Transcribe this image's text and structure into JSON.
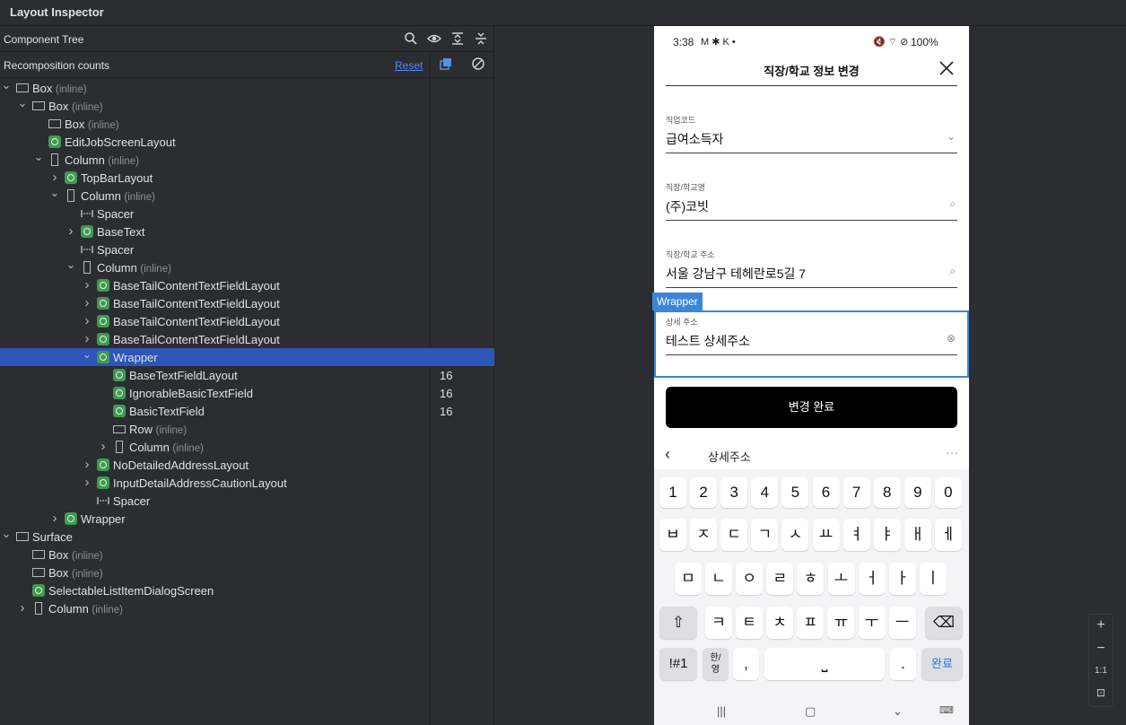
{
  "app": {
    "title": "Layout Inspector"
  },
  "component_tree": {
    "label": "Component Tree",
    "icons": [
      "search-icon",
      "eye-icon",
      "expand-all-icon",
      "collapse-all-icon"
    ]
  },
  "recomposition": {
    "label": "Recomposition counts",
    "reset_label": "Reset"
  },
  "tree_rows": [
    {
      "name": "Box",
      "inline": "(inline)",
      "type": "box",
      "depth": 0,
      "arrow": "v"
    },
    {
      "name": "Box",
      "inline": "(inline)",
      "type": "box",
      "depth": 1,
      "arrow": "v"
    },
    {
      "name": "Box",
      "inline": "(inline)",
      "type": "box",
      "depth": 2,
      "arrow": ""
    },
    {
      "name": "EditJobScreenLayout",
      "inline": "",
      "type": "compose",
      "depth": 2,
      "arrow": ""
    },
    {
      "name": "Column",
      "inline": "(inline)",
      "type": "col",
      "depth": 2,
      "arrow": "v"
    },
    {
      "name": "TopBarLayout",
      "inline": "",
      "type": "compose",
      "depth": 3,
      "arrow": ">"
    },
    {
      "name": "Column",
      "inline": "(inline)",
      "type": "col",
      "depth": 3,
      "arrow": "v"
    },
    {
      "name": "Spacer",
      "inline": "",
      "type": "spacer",
      "depth": 4,
      "arrow": ""
    },
    {
      "name": "BaseText",
      "inline": "",
      "type": "compose",
      "depth": 4,
      "arrow": ">"
    },
    {
      "name": "Spacer",
      "inline": "",
      "type": "spacer",
      "depth": 4,
      "arrow": ""
    },
    {
      "name": "Column",
      "inline": "(inline)",
      "type": "col",
      "depth": 4,
      "arrow": "v"
    },
    {
      "name": "BaseTailContentTextFieldLayout",
      "inline": "",
      "type": "compose",
      "depth": 5,
      "arrow": ">"
    },
    {
      "name": "BaseTailContentTextFieldLayout",
      "inline": "",
      "type": "compose",
      "depth": 5,
      "arrow": ">"
    },
    {
      "name": "BaseTailContentTextFieldLayout",
      "inline": "",
      "type": "compose",
      "depth": 5,
      "arrow": ">"
    },
    {
      "name": "BaseTailContentTextFieldLayout",
      "inline": "",
      "type": "compose",
      "depth": 5,
      "arrow": ">"
    },
    {
      "name": "Wrapper",
      "inline": "",
      "type": "compose",
      "depth": 5,
      "arrow": "v",
      "selected": true
    },
    {
      "name": "BaseTextFieldLayout",
      "inline": "",
      "type": "compose",
      "depth": 6,
      "arrow": "",
      "count": "16"
    },
    {
      "name": "IgnorableBasicTextField",
      "inline": "",
      "type": "compose",
      "depth": 6,
      "arrow": "",
      "count": "16"
    },
    {
      "name": "BasicTextField",
      "inline": "",
      "type": "compose",
      "depth": 6,
      "arrow": "",
      "count": "16"
    },
    {
      "name": "Row",
      "inline": "(inline)",
      "type": "row",
      "depth": 6,
      "arrow": ""
    },
    {
      "name": "Column",
      "inline": "(inline)",
      "type": "col",
      "depth": 6,
      "arrow": ">"
    },
    {
      "name": "NoDetailedAddressLayout",
      "inline": "",
      "type": "compose",
      "depth": 5,
      "arrow": ">"
    },
    {
      "name": "InputDetailAddressCautionLayout",
      "inline": "",
      "type": "compose",
      "depth": 5,
      "arrow": ">"
    },
    {
      "name": "Spacer",
      "inline": "",
      "type": "spacer",
      "depth": 5,
      "arrow": ""
    },
    {
      "name": "Wrapper",
      "inline": "",
      "type": "compose",
      "depth": 3,
      "arrow": ">"
    },
    {
      "name": "Surface",
      "inline": "",
      "type": "box",
      "depth": 0,
      "arrow": "v"
    },
    {
      "name": "Box",
      "inline": "(inline)",
      "type": "box",
      "depth": 1,
      "arrow": ""
    },
    {
      "name": "Box",
      "inline": "(inline)",
      "type": "box",
      "depth": 1,
      "arrow": ""
    },
    {
      "name": "SelectableListItemDialogScreen",
      "inline": "",
      "type": "compose",
      "depth": 1,
      "arrow": ""
    },
    {
      "name": "Column",
      "inline": "(inline)",
      "type": "col",
      "depth": 1,
      "arrow": ">"
    }
  ],
  "phone": {
    "status": {
      "time": "3:38",
      "left_icons": "M ✱ K •",
      "right_icons": "🔇 ⌔ ⊘",
      "battery": "100%"
    },
    "topbar_title": "직장/학교 정보 변경",
    "fields": [
      {
        "label": "직업코드",
        "value": "급여소득자",
        "icon": "chevron-down-icon",
        "glyph": "⌄"
      },
      {
        "label": "직장/학교명",
        "value": "(주)코빗",
        "icon": "search-icon",
        "glyph": "⌕"
      },
      {
        "label": "직장/학교 주소",
        "value": "서울 강남구 테헤란로5길 7",
        "icon": "search-icon",
        "glyph": "⌕"
      },
      {
        "label": "상세 주소",
        "value": "테스트 상세주소",
        "icon": "clear-icon",
        "glyph": "⊗"
      }
    ],
    "wrapper_label": "Wrapper",
    "submit_label": "변경 완료",
    "keyboard": {
      "suggestion": "상세주소",
      "row1": [
        "1",
        "2",
        "3",
        "4",
        "5",
        "6",
        "7",
        "8",
        "9",
        "0"
      ],
      "row2": [
        "ㅂ",
        "ㅈ",
        "ㄷ",
        "ㄱ",
        "ㅅ",
        "ㅛ",
        "ㅕ",
        "ㅑ",
        "ㅐ",
        "ㅔ"
      ],
      "row3": [
        "ㅁ",
        "ㄴ",
        "ㅇ",
        "ㄹ",
        "ㅎ",
        "ㅗ",
        "ㅓ",
        "ㅏ",
        "ㅣ"
      ],
      "row4": [
        "ㅋ",
        "ㅌ",
        "ㅊ",
        "ㅍ",
        "ㅠ",
        "ㅜ",
        "ㅡ"
      ],
      "symbols": "!#1",
      "lang_top": "한",
      "lang_bottom": "영",
      "comma": ",",
      "period": ".",
      "done": "완료"
    }
  },
  "zoom": {
    "in": "+",
    "out": "−",
    "actual": "1:1"
  }
}
